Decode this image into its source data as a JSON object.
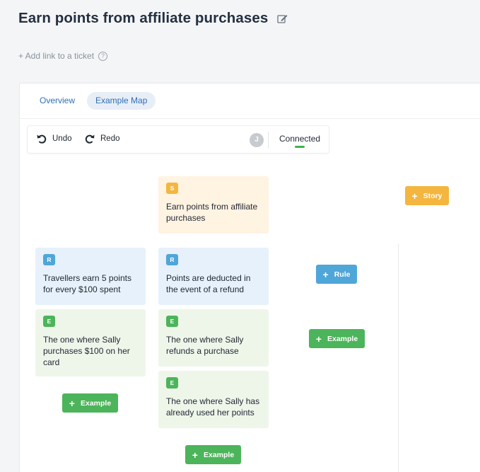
{
  "header": {
    "title": "Earn points from affiliate purchases",
    "edit_icon": "edit-icon",
    "add_link": "+ Add link to a ticket",
    "help_icon": "?"
  },
  "tabs": [
    {
      "label": "Overview",
      "active": false
    },
    {
      "label": "Example Map",
      "active": true
    }
  ],
  "toolbar": {
    "undo_label": "Undo",
    "redo_label": "Redo",
    "avatar_initial": "J",
    "status": "Connected"
  },
  "map": {
    "story": {
      "badge": "S",
      "text": "Earn points from affiliate purchases"
    },
    "rules": [
      {
        "badge": "R",
        "text": "Travellers earn 5 points for every $100 spent",
        "examples": [
          {
            "badge": "E",
            "text": "The one where Sally purchases $100 on her card"
          }
        ],
        "add_example_label": "Example"
      },
      {
        "badge": "R",
        "text": "Points are deducted in the event of a refund",
        "examples": [
          {
            "badge": "E",
            "text": "The one where Sally refunds a purchase"
          },
          {
            "badge": "E",
            "text": "The one where Sally has already used her points"
          }
        ],
        "add_example_label": "Example"
      }
    ],
    "add_rule_label": "Rule",
    "add_example_label": "Example",
    "add_story_label": "Story"
  },
  "colors": {
    "story": "#f4b63f",
    "rule": "#4fa6d8",
    "example": "#4cb45a",
    "link": "#2e6fb7"
  }
}
